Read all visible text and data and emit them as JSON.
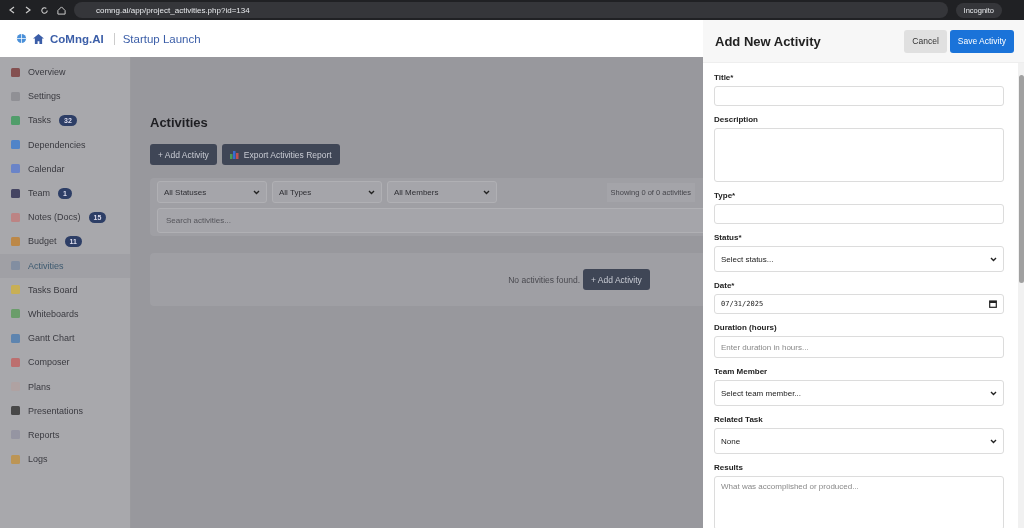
{
  "browser": {
    "url": "comng.ai/app/project_activities.php?id=134",
    "profile": "Incognito"
  },
  "header": {
    "brand": "CoMng.AI",
    "project": "Startup Launch"
  },
  "sidebar": {
    "items": [
      {
        "label": "Overview",
        "selected": false
      },
      {
        "label": "Settings",
        "selected": false
      },
      {
        "label": "Tasks",
        "badge": "32",
        "selected": false
      },
      {
        "label": "Dependencies",
        "selected": false
      },
      {
        "label": "Calendar",
        "selected": false
      },
      {
        "label": "Team",
        "badge": "1",
        "selected": false
      },
      {
        "label": "Notes (Docs)",
        "badge": "15",
        "selected": false
      },
      {
        "label": "Budget",
        "badge": "11",
        "selected": false
      },
      {
        "label": "Activities",
        "selected": true
      },
      {
        "label": "Tasks Board",
        "selected": false
      },
      {
        "label": "Whiteboards",
        "selected": false
      },
      {
        "label": "Gantt Chart",
        "selected": false
      },
      {
        "label": "Composer",
        "selected": false
      },
      {
        "label": "Plans",
        "selected": false
      },
      {
        "label": "Presentations",
        "selected": false
      },
      {
        "label": "Reports",
        "selected": false
      },
      {
        "label": "Logs",
        "selected": false
      }
    ]
  },
  "main": {
    "title": "Activities",
    "add_button": "+ Add Activity",
    "export_button": "Export Activities Report",
    "filters": [
      "All Statuses",
      "All Types",
      "All Members"
    ],
    "count": "Showing 0 of 0 activities",
    "search": {
      "placeholder": "Search activities..."
    },
    "empty_text": "No activities found.",
    "empty_button": "+ Add Activity"
  },
  "panel": {
    "title": "Add New Activity",
    "cancel": "Cancel",
    "save": "Save Activity",
    "fields": [
      {
        "label": "Title*",
        "kind": "input"
      },
      {
        "label": "Description",
        "kind": "textarea"
      },
      {
        "label": "Type*",
        "kind": "input"
      },
      {
        "label": "Status*",
        "kind": "select",
        "value": "Select status..."
      },
      {
        "label": "Date*",
        "kind": "date",
        "value": "07/31/2025"
      },
      {
        "label": "Duration (hours)",
        "kind": "input",
        "placeholder": "Enter duration in hours..."
      },
      {
        "label": "Team Member",
        "kind": "select",
        "value": "Select team member..."
      },
      {
        "label": "Related Task",
        "kind": "select",
        "value": "None"
      },
      {
        "label": "Results",
        "kind": "textarea",
        "placeholder": "What was accomplished or produced..."
      }
    ]
  }
}
